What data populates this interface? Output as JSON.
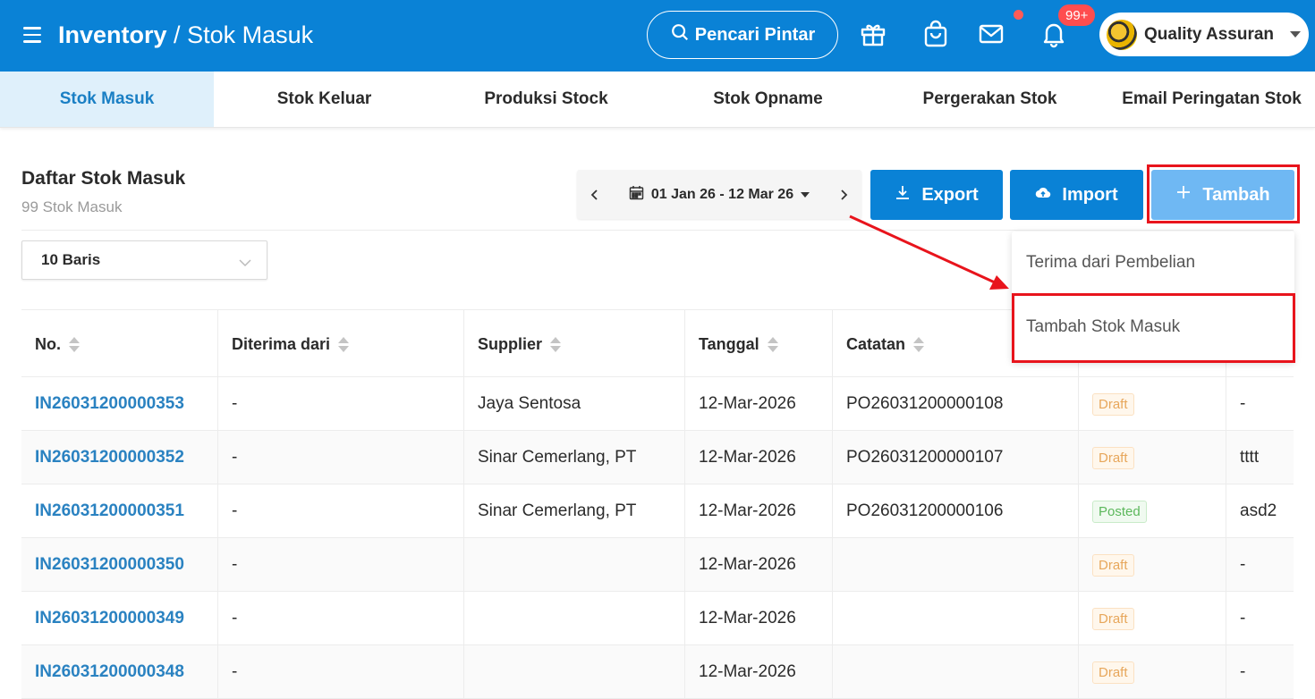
{
  "header": {
    "app_name": "Inventory",
    "separator": "/",
    "page_name": "Stok Masuk",
    "smart_search_label": "Pencari Pintar",
    "notification_count": "99+",
    "user_name": "Quality Assuran"
  },
  "tabs": [
    {
      "label": "Stok Masuk",
      "active": true
    },
    {
      "label": "Stok Keluar",
      "active": false
    },
    {
      "label": "Produksi Stock",
      "active": false
    },
    {
      "label": "Stok Opname",
      "active": false
    },
    {
      "label": "Pergerakan Stok",
      "active": false
    },
    {
      "label": "Email Peringatan Stok",
      "active": false
    }
  ],
  "list": {
    "title": "Daftar Stok Masuk",
    "subtitle": "99 Stok Masuk",
    "date_range": "01 Jan 26 - 12 Mar 26",
    "export_label": "Export",
    "import_label": "Import",
    "add_label": "Tambah",
    "rows_per_page": "10 Baris"
  },
  "dropdown": {
    "items": [
      "Terima dari Pembelian",
      "Tambah Stok Masuk"
    ]
  },
  "table": {
    "columns": [
      "No.",
      "Diterima dari",
      "Supplier",
      "Tanggal",
      "Catatan"
    ],
    "rows": [
      {
        "no": "IN26031200000353",
        "from": "-",
        "supplier": "Jaya Sentosa",
        "date": "12-Mar-2026",
        "note": "PO26031200000108",
        "status": "Draft",
        "extra": "-"
      },
      {
        "no": "IN26031200000352",
        "from": "-",
        "supplier": "Sinar Cemerlang, PT",
        "date": "12-Mar-2026",
        "note": "PO26031200000107",
        "status": "Draft",
        "extra": "tttt"
      },
      {
        "no": "IN26031200000351",
        "from": "-",
        "supplier": "Sinar Cemerlang, PT",
        "date": "12-Mar-2026",
        "note": "PO26031200000106",
        "status": "Posted",
        "extra": "asd2"
      },
      {
        "no": "IN26031200000350",
        "from": "-",
        "supplier": "",
        "date": "12-Mar-2026",
        "note": "",
        "status": "Draft",
        "extra": "-"
      },
      {
        "no": "IN26031200000349",
        "from": "-",
        "supplier": "",
        "date": "12-Mar-2026",
        "note": "",
        "status": "Draft",
        "extra": "-"
      },
      {
        "no": "IN26031200000348",
        "from": "-",
        "supplier": "",
        "date": "12-Mar-2026",
        "note": "",
        "status": "Draft",
        "extra": "-"
      }
    ]
  },
  "colors": {
    "primary": "#0a82d6",
    "add_button": "#6fb8f3",
    "highlight": "#e8141c",
    "link": "#2a82c1",
    "draft": "#e7a65a",
    "posted": "#5cb85c"
  },
  "icons": [
    "hamburger-icon",
    "search-icon",
    "gift-icon",
    "shopping-bag-icon",
    "mail-icon",
    "bell-icon",
    "calendar-icon",
    "download-icon",
    "cloud-upload-icon",
    "plus-icon"
  ]
}
